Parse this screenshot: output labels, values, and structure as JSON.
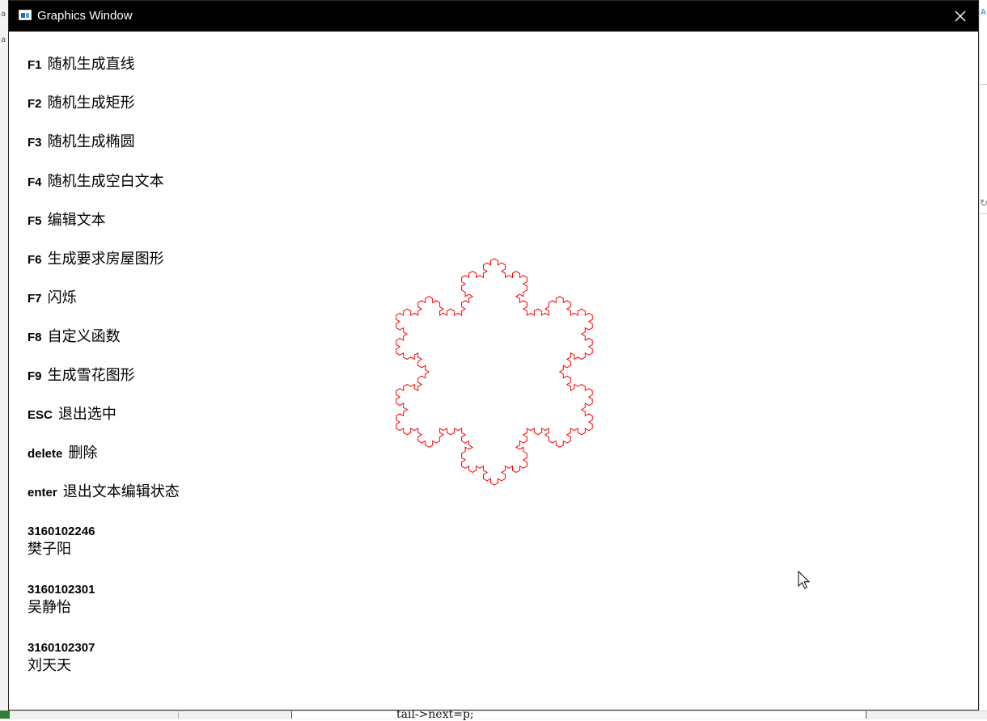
{
  "window": {
    "title": "Graphics Window",
    "close_label": "×"
  },
  "menu": [
    {
      "key": "F1",
      "label": "随机生成直线"
    },
    {
      "key": "F2",
      "label": "随机生成矩形"
    },
    {
      "key": "F3",
      "label": "随机生成椭圆"
    },
    {
      "key": "F4",
      "label": "随机生成空白文本"
    },
    {
      "key": "F5",
      "label": "编辑文本"
    },
    {
      "key": "F6",
      "label": "生成要求房屋图形"
    },
    {
      "key": "F7",
      "label": "闪烁"
    },
    {
      "key": "F8",
      "label": "自定义函数"
    },
    {
      "key": "F9",
      "label": "生成雪花图形"
    },
    {
      "key": "ESC",
      "label": "退出选中"
    },
    {
      "key": "delete",
      "label": "删除"
    },
    {
      "key": "enter",
      "label": "退出文本编辑状态"
    }
  ],
  "credits": [
    {
      "id": "3160102246",
      "name": "樊子阳"
    },
    {
      "id": "3160102301",
      "name": "吴静怡"
    },
    {
      "id": "3160102307",
      "name": "刘天天"
    }
  ],
  "snowflake": {
    "color": "#ff0000",
    "iterations": 3
  },
  "background": {
    "editor_snippet": "tail->next=p;"
  },
  "icons": {
    "app": "window-app-icon",
    "close": "close-icon",
    "cursor": "mouse-pointer-icon"
  }
}
